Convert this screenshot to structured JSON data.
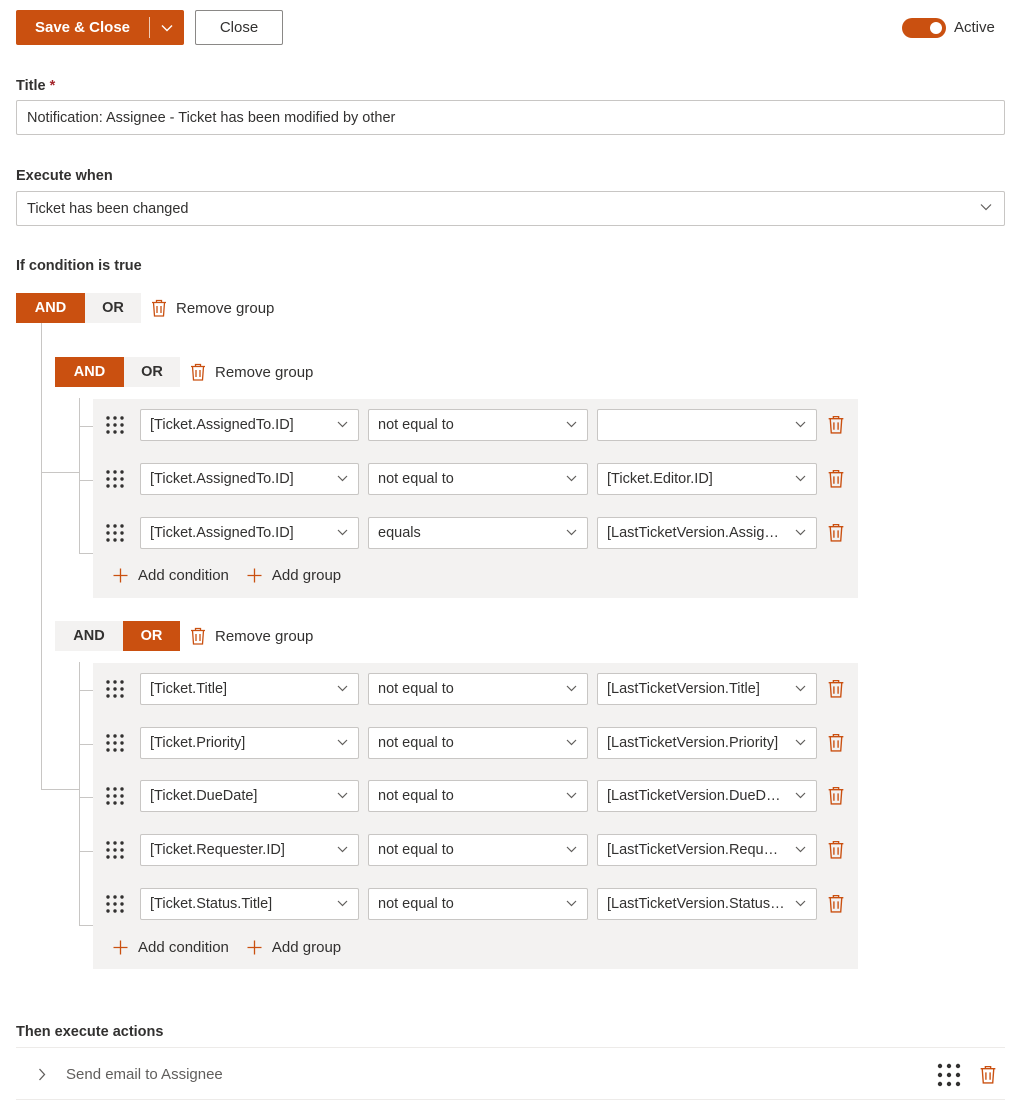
{
  "toolbar": {
    "save_close_label": "Save & Close",
    "close_label": "Close",
    "active_label": "Active",
    "active_on": true
  },
  "form": {
    "title_label": "Title",
    "title_required_mark": "*",
    "title_value": "Notification: Assignee - Ticket has been modified by other",
    "execute_when_label": "Execute when",
    "execute_when_value": "Ticket has been changed",
    "condition_label": "If condition is true",
    "actions_label": "Then execute actions"
  },
  "logic": {
    "and_label": "AND",
    "or_label": "OR",
    "remove_group_label": "Remove group",
    "add_condition_label": "Add condition",
    "add_group_label": "Add group",
    "root_operator": "AND"
  },
  "groups": [
    {
      "operator": "AND",
      "conditions": [
        {
          "field": "[Ticket.AssignedTo.ID]",
          "operator": "not equal to",
          "value": ""
        },
        {
          "field": "[Ticket.AssignedTo.ID]",
          "operator": "not equal to",
          "value": "[Ticket.Editor.ID]"
        },
        {
          "field": "[Ticket.AssignedTo.ID]",
          "operator": "equals",
          "value": "[LastTicketVersion.AssignedTo.ID]"
        }
      ]
    },
    {
      "operator": "OR",
      "conditions": [
        {
          "field": "[Ticket.Title]",
          "operator": "not equal to",
          "value": "[LastTicketVersion.Title]"
        },
        {
          "field": "[Ticket.Priority]",
          "operator": "not equal to",
          "value": "[LastTicketVersion.Priority]"
        },
        {
          "field": "[Ticket.DueDate]",
          "operator": "not equal to",
          "value": "[LastTicketVersion.DueDate]"
        },
        {
          "field": "[Ticket.Requester.ID]",
          "operator": "not equal to",
          "value": "[LastTicketVersion.Requester.ID]"
        },
        {
          "field": "[Ticket.Status.Title]",
          "operator": "not equal to",
          "value": "[LastTicketVersion.Status.Title]"
        }
      ]
    }
  ],
  "actions": [
    {
      "label": "Send email to Assignee"
    }
  ],
  "colors": {
    "accent": "#ca5010",
    "group_bg": "#f3f2f1",
    "border": "#c8c6c4"
  },
  "icons": {
    "trash": "trash-icon",
    "drag": "drag-handle-icon",
    "chevron": "chevron-down-icon",
    "plus": "plus-icon"
  }
}
